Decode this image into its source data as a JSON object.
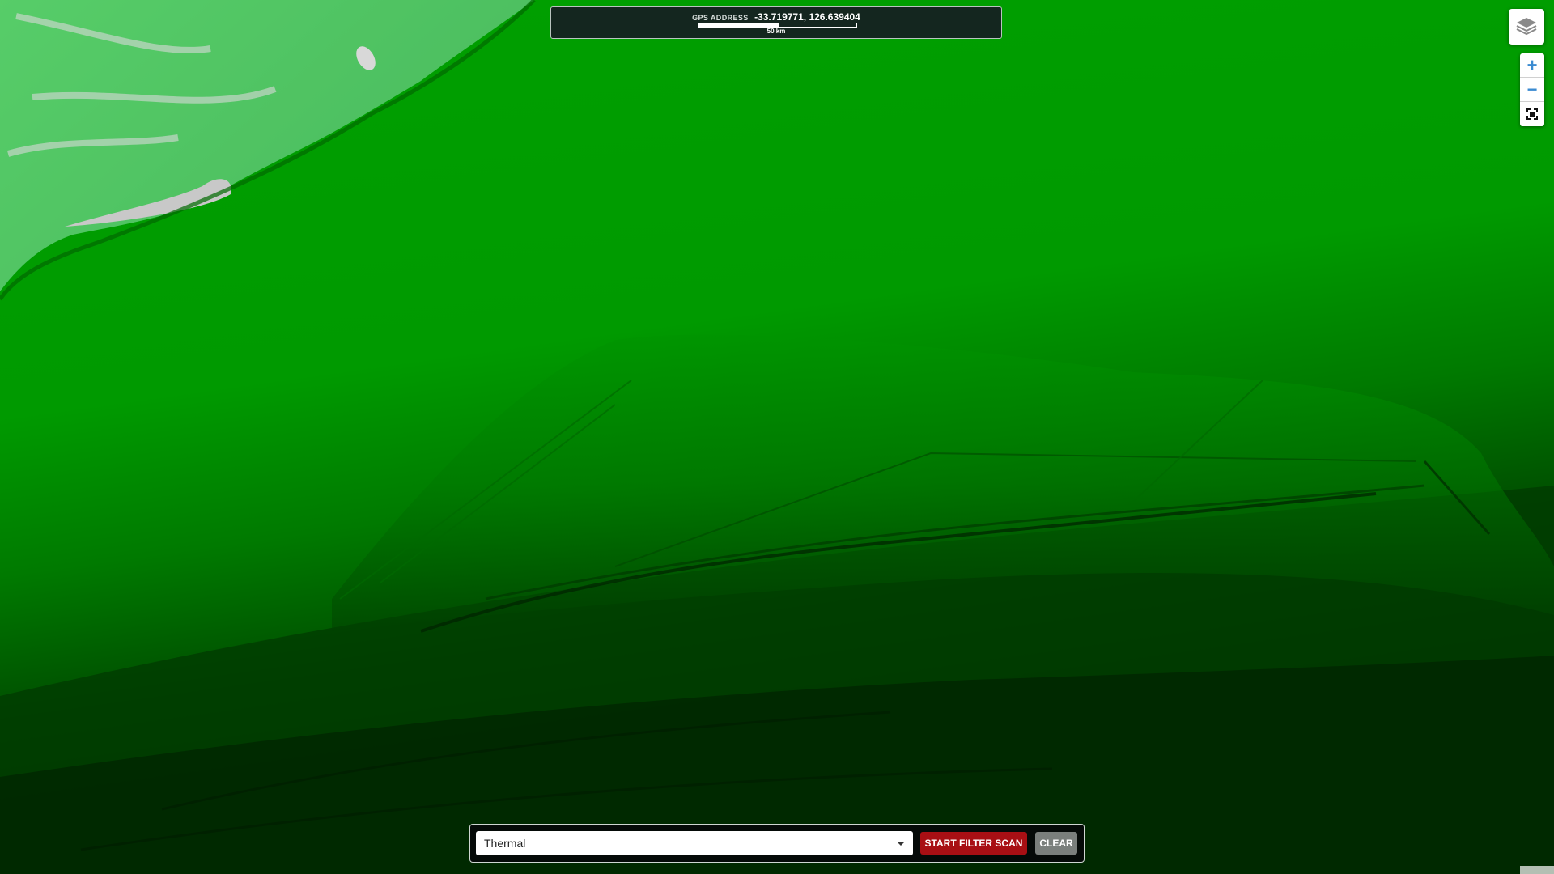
{
  "gps": {
    "label": "GPS ADDRESS",
    "coordinates": "-33.719771, 126.639404",
    "scale_label": "50 km"
  },
  "controls": {
    "layers_icon": "layers-icon",
    "zoom_in": "+",
    "zoom_out": "−",
    "fullscreen_icon": "fullscreen-icon"
  },
  "filter_bar": {
    "selected_filter": "Thermal",
    "scan_label": "START FILTER SCAN",
    "clear_label": "CLEAR"
  },
  "colors": {
    "map_bright": "#00a600",
    "map_dark": "#003300",
    "scan_button": "#a80f14",
    "clear_button": "#7a7f7c",
    "zoom_icon": "#3b8bd1"
  }
}
